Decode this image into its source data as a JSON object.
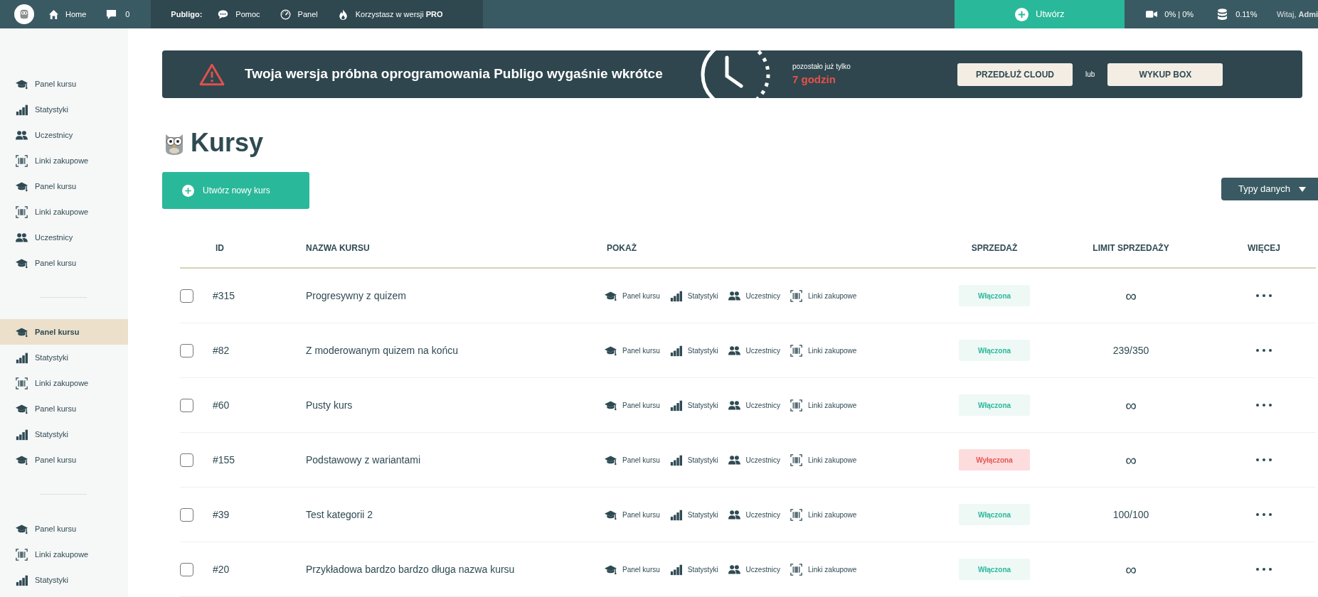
{
  "topbar": {
    "home": "Home",
    "comments": "0",
    "brand_label": "Publigo:",
    "links": [
      {
        "kind": "help",
        "label": "Pomoc"
      },
      {
        "kind": "panel",
        "label": "Panel"
      },
      {
        "kind": "fire",
        "label": "Korzystasz w wersji **PRO**"
      }
    ],
    "create": "Utwórz",
    "video_usage": "0% | 0%",
    "storage_usage": "0.11%",
    "greeting": "Witaj, **Admi**"
  },
  "sidebar": {
    "groups": [
      [
        {
          "kind": "cap",
          "label": "Panel kursu",
          "selected": false
        },
        {
          "kind": "chart",
          "label": "Statystyki",
          "selected": false
        },
        {
          "kind": "users",
          "label": "Uczestnicy",
          "selected": false
        },
        {
          "kind": "barcode",
          "label": "Linki zakupowe",
          "selected": false
        },
        {
          "kind": "cap",
          "label": "Panel kursu",
          "selected": false
        },
        {
          "kind": "barcode",
          "label": "Linki zakupowe",
          "selected": false
        },
        {
          "kind": "users",
          "label": "Uczestnicy",
          "selected": false
        },
        {
          "kind": "cap",
          "label": "Panel kursu",
          "selected": false
        }
      ],
      [
        {
          "kind": "cap",
          "label": "Panel kursu",
          "selected": true
        },
        {
          "kind": "chart",
          "label": "Statystyki",
          "selected": false
        },
        {
          "kind": "barcode",
          "label": "Linki zakupowe",
          "selected": false
        },
        {
          "kind": "cap",
          "label": "Panel kursu",
          "selected": false
        },
        {
          "kind": "chart",
          "label": "Statystyki",
          "selected": false
        },
        {
          "kind": "cap",
          "label": "Panel kursu",
          "selected": false
        }
      ],
      [
        {
          "kind": "cap",
          "label": "Panel kursu",
          "selected": false
        },
        {
          "kind": "barcode",
          "label": "Linki zakupowe",
          "selected": false
        },
        {
          "kind": "chart",
          "label": "Statystyki",
          "selected": false
        }
      ]
    ]
  },
  "banner": {
    "message": "Twoja wersja próbna oprogramowania Publigo wygaśnie wkrótce",
    "remaining_label": "pozostało już tylko",
    "remaining": "7 godzin",
    "extend_button": "PRZEDŁUŻ CLOUD",
    "or": "lub",
    "buy_button": "WYKUP BOX"
  },
  "page": {
    "title": "Kursy",
    "new_button": "Utwórz nowy kurs",
    "data_types": "Typy danych"
  },
  "table": {
    "columns": [
      "ID",
      "NAZWA KURSU",
      "POKAŻ",
      "SPRZEDAŻ",
      "LIMIT SPRZEDAŻY",
      "WIĘCEJ"
    ],
    "rows": [
      {
        "checked": false,
        "id": "#315",
        "name": "Progresywny z quizem",
        "actions": [
          {
            "kind": "cap",
            "label": "Panel kursu"
          },
          {
            "kind": "chart",
            "label": "Statystyki"
          },
          {
            "kind": "users",
            "label": "Uczestnicy"
          },
          {
            "kind": "barcode",
            "label": "Linki zakupowe"
          }
        ],
        "sales": "Włączona",
        "on": true,
        "limit": "∞"
      },
      {
        "checked": false,
        "id": "#82",
        "name": "Z moderowanym quizem na końcu",
        "actions": [
          {
            "kind": "cap",
            "label": "Panel kursu"
          },
          {
            "kind": "chart",
            "label": "Statystyki"
          },
          {
            "kind": "users",
            "label": "Uczestnicy"
          },
          {
            "kind": "barcode",
            "label": "Linki zakupowe"
          }
        ],
        "sales": "Włączona",
        "on": true,
        "limit": "239/350"
      },
      {
        "checked": false,
        "id": "#60",
        "name": "Pusty kurs",
        "actions": [
          {
            "kind": "cap",
            "label": "Panel kursu"
          },
          {
            "kind": "chart",
            "label": "Statystyki"
          },
          {
            "kind": "users",
            "label": "Uczestnicy"
          },
          {
            "kind": "barcode",
            "label": "Linki zakupowe"
          }
        ],
        "sales": "Włączona",
        "on": true,
        "limit": "∞"
      },
      {
        "checked": false,
        "id": "#155",
        "name": "Podstawowy z wariantami",
        "actions": [
          {
            "kind": "cap",
            "label": "Panel kursu"
          },
          {
            "kind": "chart",
            "label": "Statystyki"
          },
          {
            "kind": "users",
            "label": "Uczestnicy"
          },
          {
            "kind": "barcode",
            "label": "Linki zakupowe"
          }
        ],
        "sales": "Wyłączona",
        "on": false,
        "limit": "∞"
      },
      {
        "checked": false,
        "id": "#39",
        "name": "Test kategorii 2",
        "actions": [
          {
            "kind": "cap",
            "label": "Panel kursu"
          },
          {
            "kind": "chart",
            "label": "Statystyki"
          },
          {
            "kind": "users",
            "label": "Uczestnicy"
          },
          {
            "kind": "barcode",
            "label": "Linki zakupowe"
          }
        ],
        "sales": "Włączona",
        "on": true,
        "limit": "100/100"
      },
      {
        "checked": false,
        "id": "#20",
        "name": "Przykładowa bardzo bardzo długa nazwa kursu",
        "actions": [
          {
            "kind": "cap",
            "label": "Panel kursu"
          },
          {
            "kind": "chart",
            "label": "Statystyki"
          },
          {
            "kind": "users",
            "label": "Uczestnicy"
          },
          {
            "kind": "barcode",
            "label": "Linki zakupowe"
          }
        ],
        "sales": "Włączona",
        "on": true,
        "limit": "∞"
      }
    ]
  }
}
